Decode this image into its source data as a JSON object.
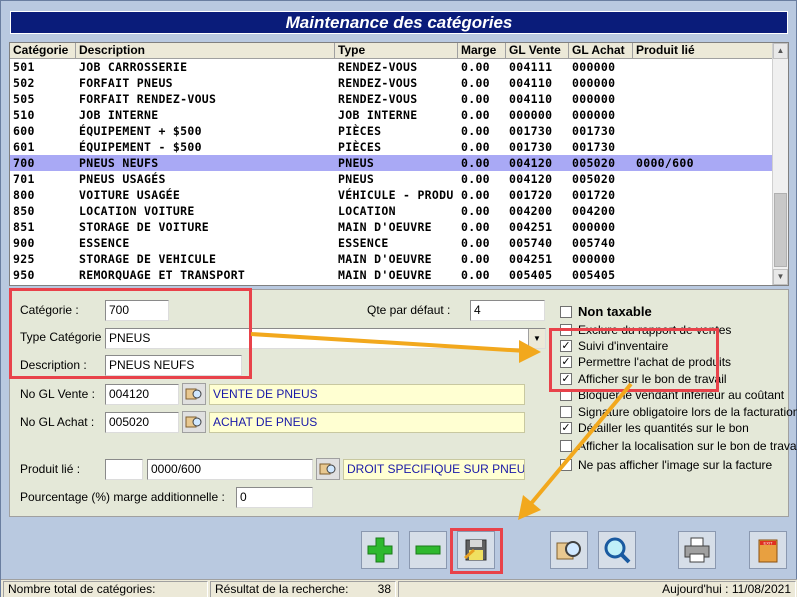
{
  "title": "Maintenance des catégories",
  "grid": {
    "headers": [
      "Catégorie",
      "Description",
      "Type",
      "Marge",
      "GL Vente",
      "GL Achat",
      "Produit lié"
    ],
    "rows": [
      [
        "501",
        "JOB CARROSSERIE",
        "RENDEZ-VOUS",
        "0.00",
        "004111",
        "000000",
        ""
      ],
      [
        "502",
        "FORFAIT PNEUS",
        "RENDEZ-VOUS",
        "0.00",
        "004110",
        "000000",
        ""
      ],
      [
        "505",
        "FORFAIT RENDEZ-VOUS",
        "RENDEZ-VOUS",
        "0.00",
        "004110",
        "000000",
        ""
      ],
      [
        "510",
        "JOB INTERNE",
        "JOB INTERNE",
        "0.00",
        "000000",
        "000000",
        ""
      ],
      [
        "600",
        "ÉQUIPEMENT + $500",
        "PIÈCES",
        "0.00",
        "001730",
        "001730",
        ""
      ],
      [
        "601",
        "ÉQUIPEMENT - $500",
        "PIÈCES",
        "0.00",
        "001730",
        "001730",
        ""
      ],
      [
        "700",
        "PNEUS NEUFS",
        "PNEUS",
        "0.00",
        "004120",
        "005020",
        "0000/600"
      ],
      [
        "701",
        "PNEUS USAGÉS",
        "PNEUS",
        "0.00",
        "004120",
        "005020",
        ""
      ],
      [
        "800",
        "VOITURE USAGÉE",
        "VÉHICULE - PRODU",
        "0.00",
        "001720",
        "001720",
        ""
      ],
      [
        "850",
        "LOCATION VOITURE",
        "LOCATION",
        "0.00",
        "004200",
        "004200",
        ""
      ],
      [
        "851",
        "STORAGE DE VOITURE",
        "MAIN D'OEUVRE",
        "0.00",
        "004251",
        "000000",
        ""
      ],
      [
        "900",
        "ESSENCE",
        "ESSENCE",
        "0.00",
        "005740",
        "005740",
        ""
      ],
      [
        "925",
        "STORAGE DE VEHICULE",
        "MAIN D'OEUVRE",
        "0.00",
        "004251",
        "000000",
        ""
      ],
      [
        "950",
        "REMORQUAGE ET TRANSPORT",
        "MAIN D'OEUVRE",
        "0.00",
        "005405",
        "005405",
        ""
      ]
    ],
    "selected_index": 6
  },
  "form": {
    "categorie_label": "Catégorie :",
    "categorie_value": "700",
    "type_label": "Type Catégorie :",
    "type_value": "PNEUS",
    "description_label": "Description :",
    "description_value": "PNEUS NEUFS",
    "glvente_label": "No GL Vente :",
    "glvente_value": "004120",
    "glvente_desc": "VENTE DE PNEUS",
    "glachat_label": "No GL Achat :",
    "glachat_value": "005020",
    "glachat_desc": "ACHAT DE PNEUS",
    "produit_label": "Produit lié :",
    "produit_prefix": "",
    "produit_value": "0000/600",
    "produit_desc": "DROIT SPECIFIQUE SUR PNEUS",
    "pourcentage_label": "Pourcentage (%) marge additionnelle :",
    "pourcentage_value": "0",
    "qte_label": "Qte par défaut :",
    "qte_value": "4"
  },
  "checkboxes": [
    {
      "label": "Non taxable",
      "checked": false
    },
    {
      "label": "Exclure du rapport de ventes",
      "checked": false
    },
    {
      "label": "Suivi d'inventaire",
      "checked": true
    },
    {
      "label": "Permettre l'achat de produits",
      "checked": true
    },
    {
      "label": "Afficher sur le bon de travail",
      "checked": true
    },
    {
      "label": "Bloquer le vendant inférieur au coûtant",
      "checked": false
    },
    {
      "label": "Signature obligatoire lors de la facturation",
      "checked": false
    },
    {
      "label": "Détailler les quantités sur le bon",
      "checked": true
    },
    {
      "label": "Afficher la localisation sur le bon de travail",
      "checked": false
    },
    {
      "label": "Ne pas afficher l'image sur la facture",
      "checked": false
    }
  ],
  "toolbar": {
    "exit_label": "EXIT"
  },
  "status": {
    "total_label": "Nombre total de catégories:",
    "total_value": "",
    "search_label": "Résultat de la recherche:",
    "search_value": "38",
    "today": "Aujourd'hui : 11/08/2021"
  },
  "colors": {
    "title_bg": "#0a1c7a",
    "selected_row": "#a9a9f5",
    "highlight_red": "#e8424a",
    "arrow_orange": "#f2a81d",
    "yellow_field": "#ffffd2"
  }
}
